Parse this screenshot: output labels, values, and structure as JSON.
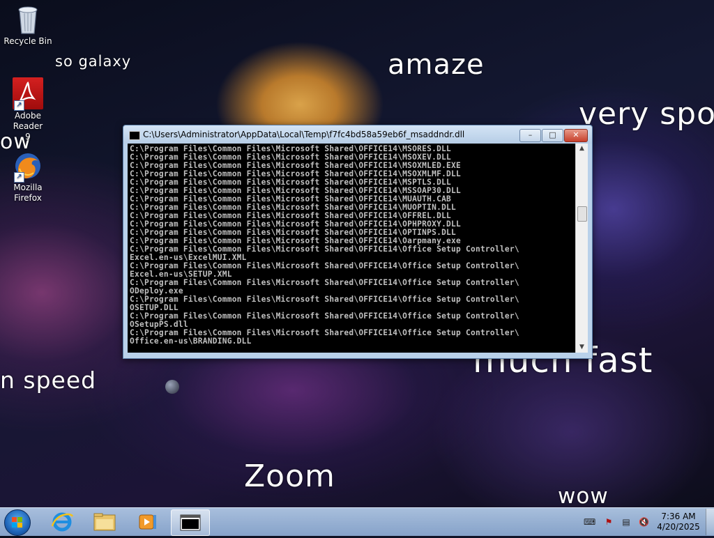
{
  "desktop": {
    "meme_texts": {
      "so_galaxy": "so galaxy",
      "amaze": "amaze",
      "very_spo": "very spo",
      "ow": "ow",
      "n_speed": "n speed",
      "much_fast": "much fast",
      "zoom": "Zoom",
      "wow": "wow"
    },
    "icons": [
      {
        "label": "Recycle Bin",
        "icon": "recycle-bin-icon"
      },
      {
        "label": "Adobe Reader\n9",
        "icon": "adobe-reader-icon"
      },
      {
        "label": "Mozilla\nFirefox",
        "icon": "firefox-icon"
      }
    ]
  },
  "window": {
    "title": "C:\\Users\\Administrator\\AppData\\Local\\Temp\\f7fc4bd58a59eb6f_msaddndr.dll",
    "buttons": {
      "minimize": "–",
      "maximize": "□",
      "close": "✕"
    },
    "console_lines": [
      "C:\\Program Files\\Common Files\\Microsoft Shared\\OFFICE14\\MSORES.DLL",
      "C:\\Program Files\\Common Files\\Microsoft Shared\\OFFICE14\\MSOXEV.DLL",
      "C:\\Program Files\\Common Files\\Microsoft Shared\\OFFICE14\\MSOXMLED.EXE",
      "C:\\Program Files\\Common Files\\Microsoft Shared\\OFFICE14\\MSOXMLMF.DLL",
      "C:\\Program Files\\Common Files\\Microsoft Shared\\OFFICE14\\MSPTLS.DLL",
      "C:\\Program Files\\Common Files\\Microsoft Shared\\OFFICE14\\MSSOAP30.DLL",
      "C:\\Program Files\\Common Files\\Microsoft Shared\\OFFICE14\\MUAUTH.CAB",
      "C:\\Program Files\\Common Files\\Microsoft Shared\\OFFICE14\\MUOPTIN.DLL",
      "C:\\Program Files\\Common Files\\Microsoft Shared\\OFFICE14\\OFFREL.DLL",
      "C:\\Program Files\\Common Files\\Microsoft Shared\\OFFICE14\\OPHPROXY.DLL",
      "C:\\Program Files\\Common Files\\Microsoft Shared\\OFFICE14\\OPTINPS.DLL",
      "C:\\Program Files\\Common Files\\Microsoft Shared\\OFFICE14\\Oarpmany.exe",
      "C:\\Program Files\\Common Files\\Microsoft Shared\\OFFICE14\\Office Setup Controller\\",
      "Excel.en-us\\ExcelMUI.XML",
      "C:\\Program Files\\Common Files\\Microsoft Shared\\OFFICE14\\Office Setup Controller\\",
      "Excel.en-us\\SETUP.XML",
      "C:\\Program Files\\Common Files\\Microsoft Shared\\OFFICE14\\Office Setup Controller\\",
      "ODeploy.exe",
      "C:\\Program Files\\Common Files\\Microsoft Shared\\OFFICE14\\Office Setup Controller\\",
      "OSETUP.DLL",
      "C:\\Program Files\\Common Files\\Microsoft Shared\\OFFICE14\\Office Setup Controller\\",
      "OSetupPS.dll",
      "C:\\Program Files\\Common Files\\Microsoft Shared\\OFFICE14\\Office Setup Controller\\",
      "Office.en-us\\BRANDING.DLL"
    ]
  },
  "taskbar": {
    "pinned": [
      {
        "icon": "internet-explorer-icon"
      },
      {
        "icon": "file-explorer-icon"
      },
      {
        "icon": "media-player-icon"
      },
      {
        "icon": "console-window-icon",
        "active": true
      }
    ],
    "tray": [
      {
        "icon": "keyboard-icon"
      },
      {
        "icon": "action-center-flag-icon"
      },
      {
        "icon": "network-icon"
      },
      {
        "icon": "volume-muted-icon"
      }
    ],
    "time": "7:36 AM",
    "date": "4/20/2025"
  },
  "colors": {
    "console_bg": "#000000",
    "console_fg": "#c0c0c0",
    "title_bar": "#b9d1ea",
    "close_button": "#c7402c",
    "taskbar": "#a9c3e3"
  }
}
